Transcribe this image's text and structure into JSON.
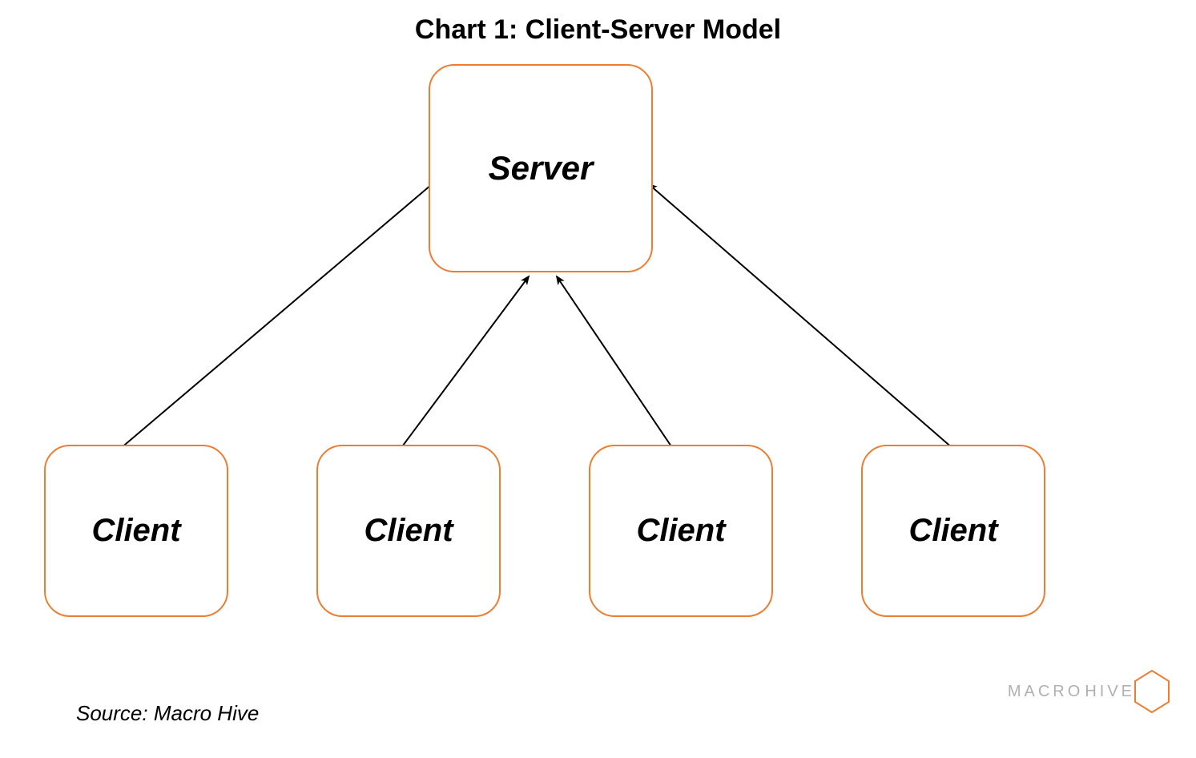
{
  "title": "Chart 1: Client-Server Model",
  "server": {
    "label": "Server"
  },
  "clients": [
    {
      "label": "Client"
    },
    {
      "label": "Client"
    },
    {
      "label": "Client"
    },
    {
      "label": "Client"
    }
  ],
  "source": "Source: Macro Hive",
  "logo": {
    "macro": "MACRO",
    "hive": "HIVE"
  },
  "colors": {
    "accent": "#ed7d31"
  },
  "chart_data": {
    "type": "diagram",
    "title": "Chart 1: Client-Server Model",
    "nodes": [
      {
        "id": "server",
        "label": "Server",
        "role": "server"
      },
      {
        "id": "client1",
        "label": "Client",
        "role": "client"
      },
      {
        "id": "client2",
        "label": "Client",
        "role": "client"
      },
      {
        "id": "client3",
        "label": "Client",
        "role": "client"
      },
      {
        "id": "client4",
        "label": "Client",
        "role": "client"
      }
    ],
    "edges": [
      {
        "from": "client1",
        "to": "server"
      },
      {
        "from": "client2",
        "to": "server"
      },
      {
        "from": "client3",
        "to": "server"
      },
      {
        "from": "client4",
        "to": "server"
      }
    ],
    "source": "Macro Hive"
  }
}
